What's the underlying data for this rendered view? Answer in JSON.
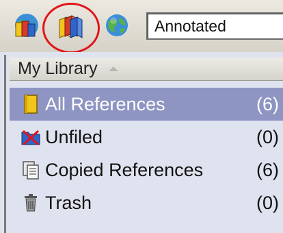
{
  "toolbar": {
    "buttons": [
      {
        "name": "online-search",
        "icon": "globe-books-icon"
      },
      {
        "name": "local-library",
        "icon": "books-icon",
        "highlighted": true
      },
      {
        "name": "web",
        "icon": "globe-icon"
      }
    ],
    "mode_value": "Annotated",
    "highlight_color": "#e0151a"
  },
  "library": {
    "header": "My Library",
    "items": [
      {
        "label": "All References",
        "count": "(6)",
        "icon": "reference-book-icon",
        "selected": true
      },
      {
        "label": "Unfiled",
        "count": "(0)",
        "icon": "unfiled-folder-icon",
        "selected": false
      },
      {
        "label": "Copied References",
        "count": "(6)",
        "icon": "copy-documents-icon",
        "selected": false
      },
      {
        "label": "Trash",
        "count": "(0)",
        "icon": "trash-can-icon",
        "selected": false
      }
    ],
    "selected_color": "#8e95c2"
  }
}
